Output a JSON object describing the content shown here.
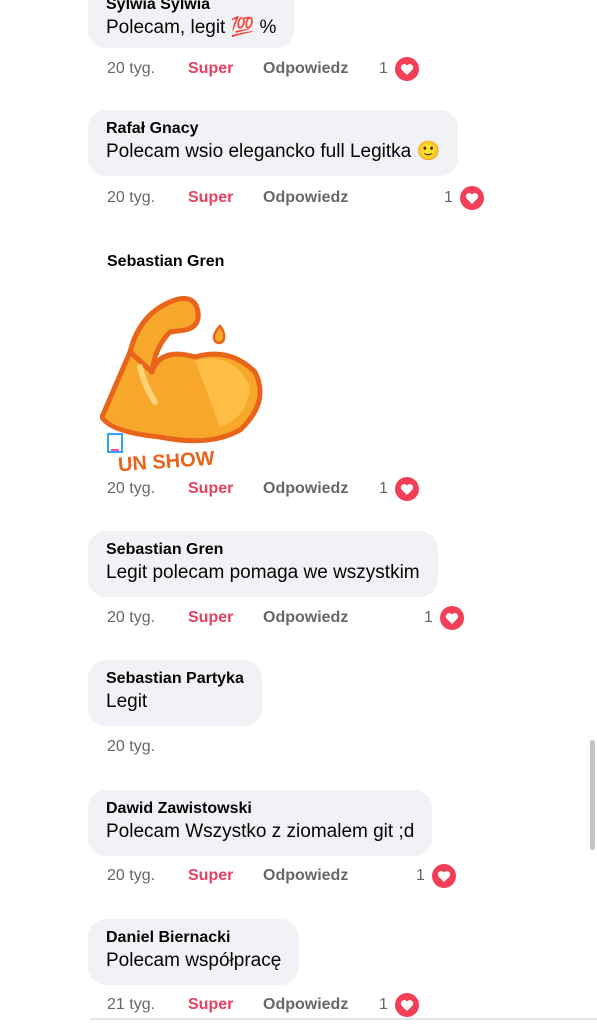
{
  "comments": [
    {
      "author": "Sylwia Sylwia",
      "text": "Polecam, legit 💯 %",
      "time": "20 tyg.",
      "super": "Super",
      "reply": "Odpowiedz",
      "count": "1"
    },
    {
      "author": "Rafał Gnacy",
      "text": "Polecam wsio elegancko full Legitka 🙂",
      "time": "20 tyg.",
      "super": "Super",
      "reply": "Odpowiedz",
      "count": "1"
    },
    {
      "author": "Sebastian Gren",
      "sticker_text": "UN SHOW",
      "time": "20 tyg.",
      "super": "Super",
      "reply": "Odpowiedz",
      "count": "1"
    },
    {
      "author": "Sebastian Gren",
      "text": "Legit polecam pomaga we wszystkim",
      "time": "20 tyg.",
      "super": "Super",
      "reply": "Odpowiedz",
      "count": "1"
    },
    {
      "author": "Sebastian Partyka",
      "text": "Legit",
      "time": "20 tyg."
    },
    {
      "author": "Dawid Zawistowski",
      "text": "Polecam Wszystko z ziomalem git ;d",
      "time": "20 tyg.",
      "super": "Super",
      "reply": "Odpowiedz",
      "count": "1"
    },
    {
      "author": "Daniel Biernacki",
      "text": "Polecam współpracę",
      "time": "21 tyg.",
      "super": "Super",
      "reply": "Odpowiedz",
      "count": "1"
    }
  ],
  "colors": {
    "bubble": "#f0f2f5",
    "super": "#e4405f",
    "heart": "#f33e58",
    "meta": "#65676b",
    "sticker": "#f7a72a"
  },
  "icons": {
    "reaction": "heart-icon",
    "sticker_badge": "document-icon"
  }
}
